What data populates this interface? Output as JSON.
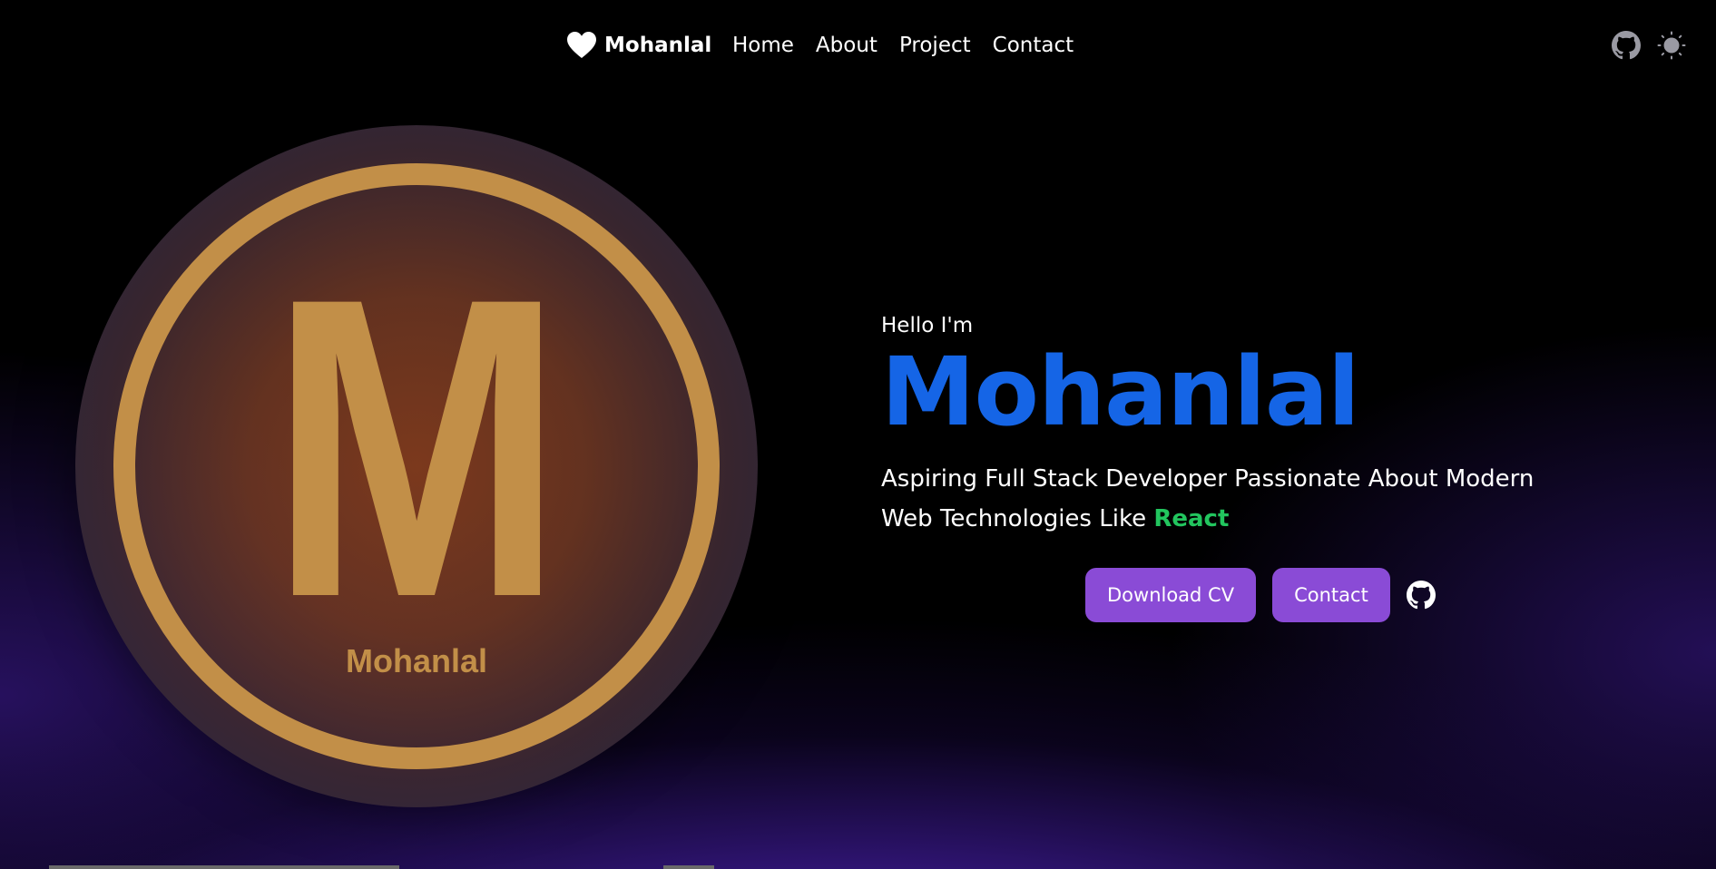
{
  "nav": {
    "brand_icon": "heart-icon",
    "brand_name": "Mohanlal",
    "links": [
      {
        "label": "Home"
      },
      {
        "label": "About"
      },
      {
        "label": "Project"
      },
      {
        "label": "Contact"
      }
    ],
    "right_icons": [
      "github-icon",
      "sun-icon"
    ]
  },
  "hero": {
    "logo": {
      "letter": "M",
      "caption": "Mohanlal",
      "gold_color": "#c28f48"
    },
    "greeting": "Hello I'm",
    "name": "Mohanlal",
    "tagline_part1": "Aspiring Full Stack Developer Passionate About Modern Web Technologies Like",
    "tagline_highlight": "React",
    "buttons": {
      "download_cv": "Download CV",
      "contact": "Contact"
    },
    "social_icon": "github-icon"
  },
  "colors": {
    "accent_blue": "#1565e6",
    "highlight_green": "#22c55e",
    "button_purple": "#8a4bd6",
    "background_glow": "#4a22b0"
  }
}
